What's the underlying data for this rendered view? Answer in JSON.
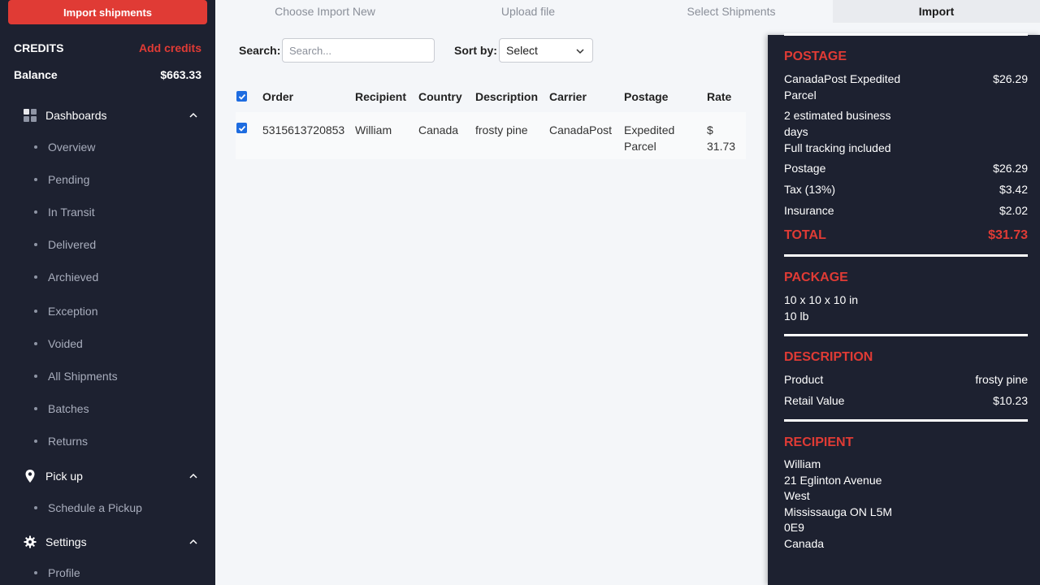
{
  "sidebar": {
    "import_button": "Import shipments",
    "credits_label": "CREDITS",
    "add_credits": "Add credits",
    "balance_label": "Balance",
    "balance_value": "$663.33",
    "dashboards": {
      "label": "Dashboards",
      "items": [
        "Overview",
        "Pending",
        "In Transit",
        "Delivered",
        "Archieved",
        "Exception",
        "Voided",
        "All Shipments",
        "Batches",
        "Returns"
      ]
    },
    "pickup": {
      "label": "Pick up",
      "items": [
        "Schedule a Pickup"
      ]
    },
    "settings": {
      "label": "Settings",
      "items": [
        "Profile"
      ]
    }
  },
  "stepper": {
    "steps": [
      "Choose Import New",
      "Upload file",
      "Select Shipments",
      "Import"
    ],
    "active_index": 3
  },
  "toolbar": {
    "search_label": "Search:",
    "search_placeholder": "Search...",
    "sort_label": "Sort by:",
    "sort_value": "Select"
  },
  "table": {
    "headers": [
      "Order",
      "Recipient",
      "Country",
      "Description",
      "Carrier",
      "Postage",
      "Rate"
    ],
    "rows": [
      {
        "checked": true,
        "order": "5315613720853",
        "recipient": "William",
        "country": "Canada",
        "description": "frosty pine",
        "carrier": "CanadaPost",
        "postage_line1": "Expedited",
        "postage_line2": "Parcel",
        "rate_line1": "$",
        "rate_line2": "31.73"
      }
    ]
  },
  "panel": {
    "postage": {
      "title": "POSTAGE",
      "service_line1": "CanadaPost Expedited",
      "service_line2": "Parcel",
      "service_price": "$26.29",
      "estimate_line1": "2 estimated business",
      "estimate_line2": "days",
      "tracking": "Full tracking included",
      "postage_label": "Postage",
      "postage_value": "$26.29",
      "tax_label": "Tax (13%)",
      "tax_value": "$3.42",
      "insurance_label": "Insurance",
      "insurance_value": "$2.02",
      "total_label": "TOTAL",
      "total_value": "$31.73"
    },
    "package": {
      "title": "PACKAGE",
      "dimensions": "10 x 10 x 10 in",
      "weight": "10 lb"
    },
    "description": {
      "title": "DESCRIPTION",
      "product_label": "Product",
      "product_value": "frosty pine",
      "retail_label": "Retail Value",
      "retail_value": "$10.23"
    },
    "recipient": {
      "title": "RECIPIENT",
      "name": "William",
      "address_line1": "21 Eglinton Avenue",
      "address_line2": "West",
      "city_line1": "Mississauga ON L5M",
      "city_line2": "0E9",
      "country": "Canada"
    }
  },
  "colors": {
    "accent": "#e03b35",
    "sidebar_bg": "#1d2130",
    "checkbox": "#1e6ce0"
  }
}
